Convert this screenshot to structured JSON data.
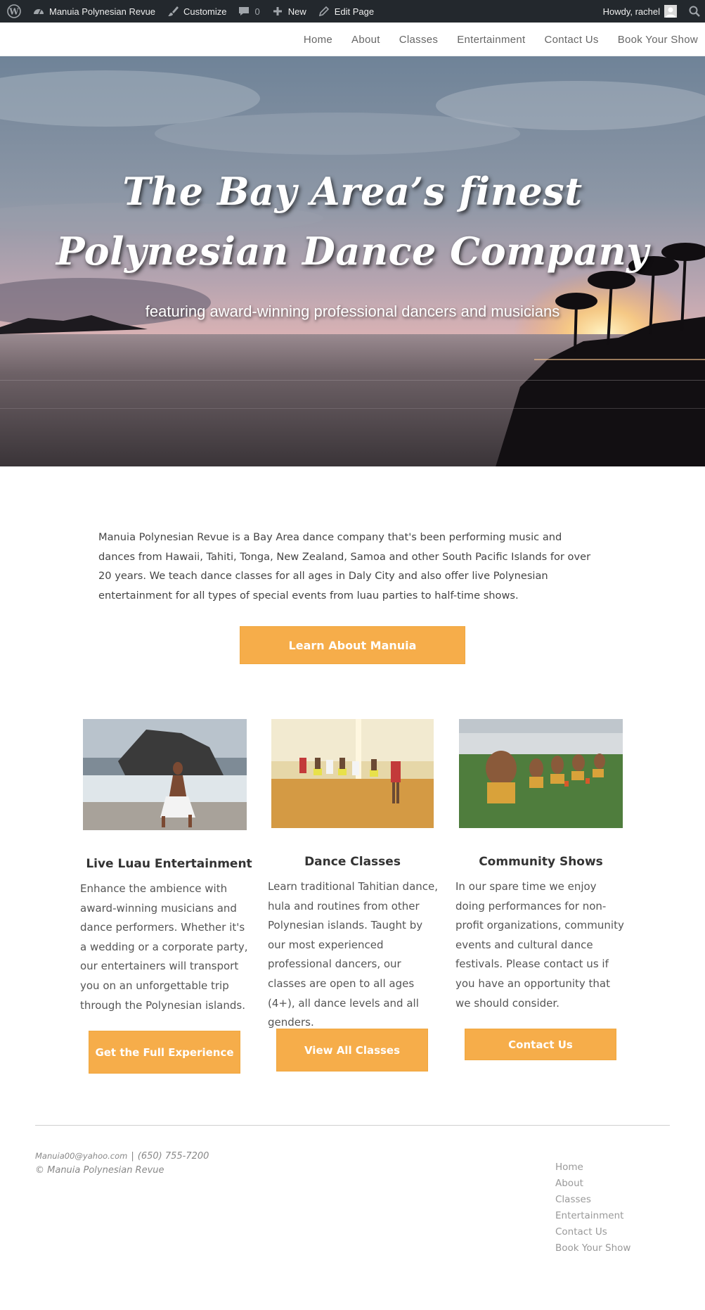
{
  "admin_bar": {
    "site_name": "Manuia Polynesian Revue",
    "customize": "Customize",
    "comments_count": "0",
    "new": "New",
    "edit_page": "Edit Page",
    "howdy": "Howdy, rachel"
  },
  "nav": {
    "items": [
      "Home",
      "About",
      "Classes",
      "Entertainment",
      "Contact Us",
      "Book Your Show"
    ]
  },
  "hero": {
    "title_line1": "The Bay Area’s finest",
    "title_line2": "Polynesian Dance Company",
    "subtitle": "featuring award-winning professional dancers and musicians"
  },
  "intro": {
    "text": "Manuia Polynesian Revue is a Bay Area dance company that's been performing music and dances from Hawaii, Tahiti, Tonga, New Zealand, Samoa and other South Pacific Islands for over 20 years. We teach dance classes for all ages in Daly City and also offer live Polynesian entertainment for all types of special events from luau parties to half-time shows.",
    "button": "Learn About Manuia"
  },
  "columns": [
    {
      "title": "Live Luau Entertainment",
      "text": "Enhance the ambience with award-winning musicians and dance performers. Whether it's a wedding or a corporate party, our entertainers will transport you on an unforgettable trip through the Polynesian islands.",
      "button": "Get the Full Experience"
    },
    {
      "title": "Dance Classes",
      "text": "Learn traditional Tahitian dance, hula and routines from other Polynesian islands. Taught by our most experienced professional dancers, our classes are open to all ages (4+), all dance levels and all genders.",
      "button": "View All Classes"
    },
    {
      "title": "Community Shows",
      "text": "In our spare time we enjoy doing performances for non-profit organizations, community events and cultural dance festivals. Please contact us if you have an opportunity that we should consider.",
      "button": "Contact Us"
    }
  ],
  "footer": {
    "email": "Manuia00@yahoo.com",
    "separator": "|",
    "phone": "(650) 755-7200",
    "copyright": "© Manuia Polynesian Revue",
    "nav": [
      "Home",
      "About",
      "Classes",
      "Entertainment",
      "Contact Us",
      "Book Your Show"
    ]
  },
  "colors": {
    "accent": "#f6ad4a",
    "admin_bar": "#23282d"
  }
}
